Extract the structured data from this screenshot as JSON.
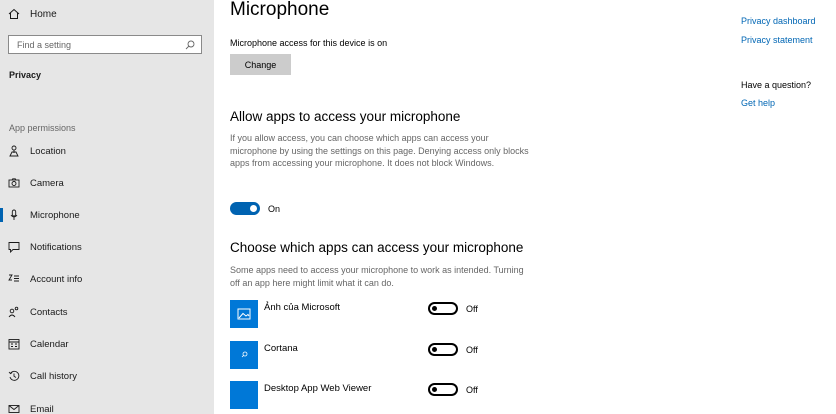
{
  "sidebar": {
    "home_label": "Home",
    "search_placeholder": "Find a setting",
    "section_title": "Privacy",
    "group_label": "App permissions",
    "items": [
      {
        "label": "Location",
        "icon": "location-icon"
      },
      {
        "label": "Camera",
        "icon": "camera-icon"
      },
      {
        "label": "Microphone",
        "icon": "microphone-icon",
        "active": true
      },
      {
        "label": "Notifications",
        "icon": "notifications-icon"
      },
      {
        "label": "Account info",
        "icon": "account-info-icon"
      },
      {
        "label": "Contacts",
        "icon": "contacts-icon"
      },
      {
        "label": "Calendar",
        "icon": "calendar-icon"
      },
      {
        "label": "Call history",
        "icon": "call-history-icon"
      },
      {
        "label": "Email",
        "icon": "email-icon"
      }
    ]
  },
  "main": {
    "title": "Microphone",
    "device_status": "Microphone access for this device is on",
    "change_label": "Change",
    "allow": {
      "heading": "Allow apps to access your microphone",
      "description": "If you allow access, you can choose which apps can access your microphone by using the settings on this page. Denying access only blocks apps from accessing your microphone. It does not block Windows.",
      "toggle_state": "On"
    },
    "choose": {
      "heading": "Choose which apps can access your microphone",
      "description": "Some apps need to access your microphone to work as intended. Turning off an app here might limit what it can do.",
      "apps": [
        {
          "name": "Ảnh của Microsoft",
          "state": "Off",
          "icon": "photos-icon"
        },
        {
          "name": "Cortana",
          "state": "Off",
          "icon": "cortana-icon"
        },
        {
          "name": "Desktop App Web Viewer",
          "state": "Off",
          "icon": "web-viewer-icon"
        }
      ]
    }
  },
  "right": {
    "partial_link": "Privacy dashboard",
    "privacy_statement": "Privacy statement",
    "question": "Have a question?",
    "get_help": "Get help"
  },
  "colors": {
    "accent": "#0063b1",
    "sidebar_bg": "#e6e6e6",
    "link": "#0066b4",
    "app_tile": "#0078d7"
  }
}
